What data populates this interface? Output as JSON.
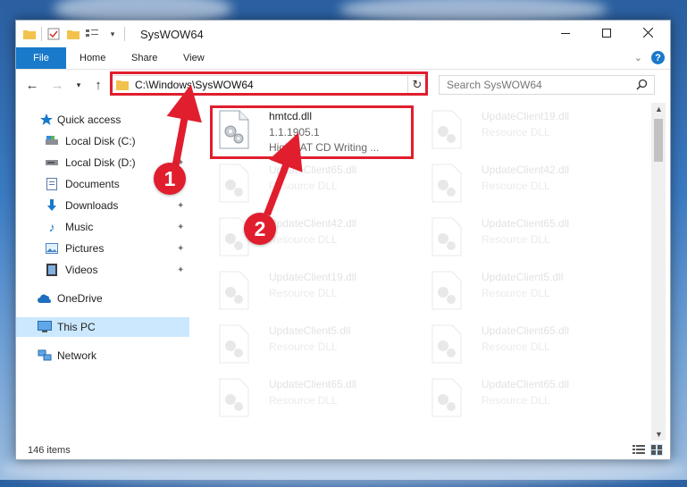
{
  "window": {
    "title": "SysWOW64",
    "controls": {
      "minimize": "minimize-icon",
      "maximize": "maximize-icon",
      "close": "close-icon"
    }
  },
  "ribbon": {
    "tabs": [
      "File",
      "Home",
      "Share",
      "View"
    ],
    "expand_icon": "chevron-down-icon",
    "help_label": "?"
  },
  "address_bar": {
    "path": "C:\\Windows\\SysWOW64",
    "search_placeholder": "Search SysWOW64"
  },
  "sidebar": {
    "items": [
      {
        "label": "Quick access",
        "icon": "star-icon",
        "pinned": false
      },
      {
        "label": "Local Disk (C:)",
        "icon": "drive-icon",
        "pinned": true
      },
      {
        "label": "Local Disk (D:)",
        "icon": "drive-icon",
        "pinned": true
      },
      {
        "label": "Documents",
        "icon": "document-icon",
        "pinned": true
      },
      {
        "label": "Downloads",
        "icon": "download-icon",
        "pinned": true
      },
      {
        "label": "Music",
        "icon": "music-icon",
        "pinned": true
      },
      {
        "label": "Pictures",
        "icon": "pictures-icon",
        "pinned": true
      },
      {
        "label": "Videos",
        "icon": "video-icon",
        "pinned": true
      },
      {
        "label": "OneDrive",
        "icon": "cloud-icon",
        "pinned": false
      },
      {
        "label": "This PC",
        "icon": "computer-icon",
        "pinned": false,
        "selected": true
      },
      {
        "label": "Network",
        "icon": "network-icon",
        "pinned": false
      }
    ]
  },
  "files": [
    {
      "name": "hmtcd.dll",
      "version": "1.1.1905.1",
      "description": "HighMAT CD Writing ...",
      "highlighted": true
    },
    {
      "name": "UpdateClient19.dll",
      "description": "Resource DLL"
    },
    {
      "name": "UpdateClient65.dll",
      "description": "Resource DLL"
    },
    {
      "name": "UpdateClient42.dll",
      "description": "Resource DLL"
    },
    {
      "name": "UpdateClient42.dll",
      "description": "Resource DLL"
    },
    {
      "name": "UpdateClient65.dll",
      "description": "Resource DLL"
    },
    {
      "name": "UpdateClient19.dll",
      "description": "Resource DLL"
    },
    {
      "name": "UpdateClient5.dll",
      "description": "Resource DLL"
    },
    {
      "name": "UpdateClient5.dll",
      "description": "Resource DLL"
    },
    {
      "name": "UpdateClient65.dll",
      "description": "Resource DLL"
    },
    {
      "name": "UpdateClient65.dll",
      "description": "Resource DLL"
    },
    {
      "name": "UpdateClient65.dll",
      "description": "Resource DLL"
    }
  ],
  "status": {
    "item_count": "146 items"
  },
  "annotations": [
    {
      "number": "1",
      "color": "#e01e2e"
    },
    {
      "number": "2",
      "color": "#e01e2e"
    }
  ],
  "colors": {
    "accent": "#1979ca",
    "selection": "#cce8ff",
    "annotation": "#e01e2e"
  }
}
